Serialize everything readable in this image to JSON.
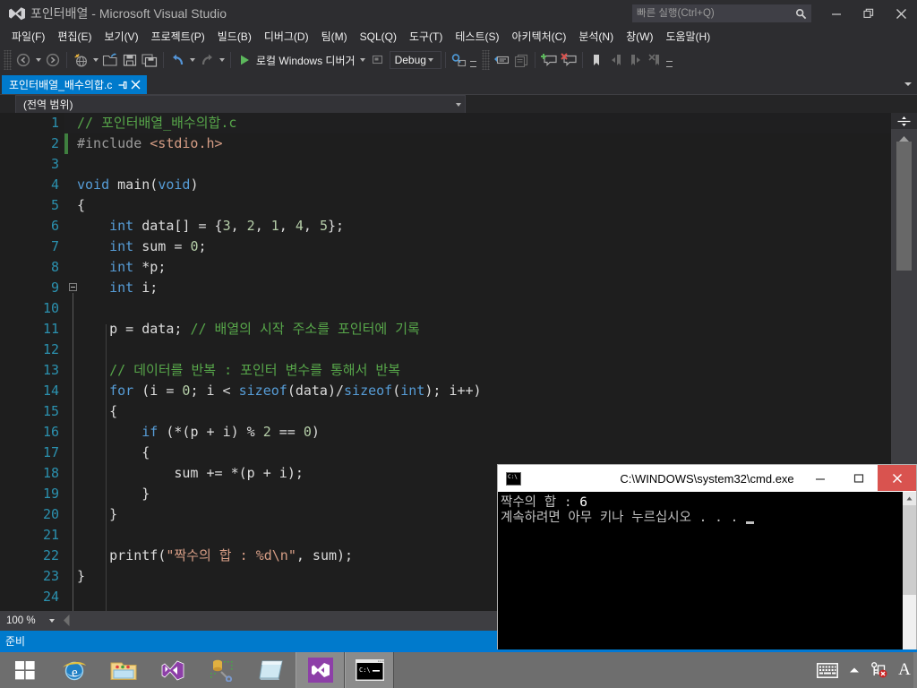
{
  "window": {
    "app_name": "Microsoft Visual Studio",
    "project_name": "포인터배열",
    "title": "포인터배열 - Microsoft Visual Studio",
    "logo_icon": "visual-studio-logo-icon",
    "minimize_icon": "minimize-icon",
    "restore_icon": "restore-icon",
    "close_icon": "close-icon",
    "accent_color": "#007acc",
    "chrome_color": "#2d2d30"
  },
  "quick_launch": {
    "placeholder": "빠른 실행(Ctrl+Q)",
    "value": "",
    "icon": "search-icon"
  },
  "menubar": {
    "items": [
      {
        "label": "파일(F)",
        "name": "menu-file"
      },
      {
        "label": "편집(E)",
        "name": "menu-edit"
      },
      {
        "label": "보기(V)",
        "name": "menu-view"
      },
      {
        "label": "프로젝트(P)",
        "name": "menu-project"
      },
      {
        "label": "빌드(B)",
        "name": "menu-build"
      },
      {
        "label": "디버그(D)",
        "name": "menu-debug"
      },
      {
        "label": "팀(M)",
        "name": "menu-team"
      },
      {
        "label": "SQL(Q)",
        "name": "menu-sql"
      },
      {
        "label": "도구(T)",
        "name": "menu-tools"
      },
      {
        "label": "테스트(S)",
        "name": "menu-test"
      },
      {
        "label": "아키텍처(C)",
        "name": "menu-architecture"
      },
      {
        "label": "분석(N)",
        "name": "menu-analyze"
      },
      {
        "label": "창(W)",
        "name": "menu-window"
      },
      {
        "label": "도움말(H)",
        "name": "menu-help"
      }
    ]
  },
  "toolbar": {
    "navigate_back_icon": "navigate-back-icon",
    "navigate_forward_icon": "navigate-forward-icon",
    "new_project_icon": "new-project-icon",
    "open_file_icon": "open-file-icon",
    "save_icon": "save-icon",
    "save_all_icon": "save-all-icon",
    "undo_icon": "undo-icon",
    "redo_icon": "redo-icon",
    "start_debug_icon": "play-triangle-icon",
    "start_debug_label": "로컬 Windows 디버거",
    "platform_target_icon": "target-platform-icon",
    "configuration_value": "Debug",
    "find_icon": "find-in-files-icon",
    "comment_icon": "comment-selection-icon",
    "uncomment_icon": "uncomment-selection-icon",
    "add_comment_icon": "add-comment-icon",
    "delete_comment_icon": "delete-comment-icon",
    "bookmark_icon": "bookmark-icon",
    "prev_bookmark_icon": "previous-bookmark-icon",
    "next_bookmark_icon": "next-bookmark-icon",
    "clear_bookmarks_icon": "clear-bookmarks-icon",
    "overflow_icon": "toolbar-overflow-icon"
  },
  "document_tab": {
    "filename": "포인터배열_배수의합.c",
    "pin_icon": "pin-icon",
    "close_icon": "close-icon",
    "dropdown_icon": "chevron-down-icon",
    "active_color": "#007acc"
  },
  "scope_bar": {
    "value": "(전역 범위)",
    "dropdown_icon": "chevron-down-icon"
  },
  "editor": {
    "filename": "포인터배열_배수의합.c",
    "language": "c",
    "total_lines_visible": 24,
    "lines": [
      {
        "n": "1",
        "text": "// 포인터배열_배수의합.c"
      },
      {
        "n": "2",
        "text": "#include <stdio.h>"
      },
      {
        "n": "3",
        "text": ""
      },
      {
        "n": "4",
        "text": "void main(void)"
      },
      {
        "n": "5",
        "text": "{"
      },
      {
        "n": "6",
        "text": "    int data[] = {3, 2, 1, 4, 5};"
      },
      {
        "n": "7",
        "text": "    int sum = 0;"
      },
      {
        "n": "8",
        "text": "    int *p;"
      },
      {
        "n": "9",
        "text": "    int i;"
      },
      {
        "n": "10",
        "text": ""
      },
      {
        "n": "11",
        "text": "    p = data; // 배열의 시작 주소를 포인터에 기록"
      },
      {
        "n": "12",
        "text": ""
      },
      {
        "n": "13",
        "text": "    // 데이터를 반복 : 포인터 변수를 통해서 반복"
      },
      {
        "n": "14",
        "text": "    for (i = 0; i < sizeof(data)/sizeof(int); i++)"
      },
      {
        "n": "15",
        "text": "    {"
      },
      {
        "n": "16",
        "text": "        if (*(p + i) % 2 == 0)"
      },
      {
        "n": "17",
        "text": "        {"
      },
      {
        "n": "18",
        "text": "            sum += *(p + i);"
      },
      {
        "n": "19",
        "text": "        }"
      },
      {
        "n": "20",
        "text": "    }"
      },
      {
        "n": "21",
        "text": ""
      },
      {
        "n": "22",
        "text": "    printf(\"짝수의 합 : %d\\n\", sum);"
      },
      {
        "n": "23",
        "text": "}"
      },
      {
        "n": "24",
        "text": ""
      }
    ],
    "splitter_icon": "horizontal-splitter-icon",
    "scroll_up_icon": "scroll-up-icon"
  },
  "zoom_bar": {
    "zoom_level": "100 %",
    "dropdown_icon": "chevron-down-icon",
    "scroll_left_icon": "scroll-left-icon"
  },
  "status_bar": {
    "text": "준비",
    "color": "#007acc"
  },
  "console": {
    "title": "C:\\WINDOWS\\system32\\cmd.exe",
    "icon": "cmd-console-icon",
    "minimize_icon": "minimize-icon",
    "maximize_icon": "maximize-icon",
    "close_icon": "close-icon",
    "close_color": "#d9534f",
    "output_line1_label": "짝수의 합 : ",
    "output_line1_value": "6",
    "output_line2": "계속하려면 아무 키나 누르십시오 . . .",
    "cursor": "block-cursor"
  },
  "taskbar": {
    "items": [
      {
        "name": "start-button",
        "icon": "windows-logo-icon",
        "active": false
      },
      {
        "name": "taskbar-internet-explorer",
        "icon": "internet-explorer-icon",
        "active": false
      },
      {
        "name": "taskbar-file-explorer",
        "icon": "file-explorer-icon",
        "active": false
      },
      {
        "name": "taskbar-visual-studio",
        "icon": "visual-studio-icon",
        "active": false
      },
      {
        "name": "taskbar-sql-tools",
        "icon": "database-tools-icon",
        "active": false
      },
      {
        "name": "taskbar-notepad",
        "icon": "notepad-icon",
        "active": false
      },
      {
        "name": "taskbar-visual-studio-running",
        "icon": "visual-studio-icon",
        "active": true
      },
      {
        "name": "taskbar-cmd-running",
        "icon": "cmd-console-icon",
        "active": true
      }
    ],
    "tray": [
      {
        "name": "tray-touch-keyboard",
        "icon": "keyboard-icon"
      },
      {
        "name": "tray-show-hidden-icons",
        "icon": "chevron-up-icon"
      },
      {
        "name": "tray-network-disconnected",
        "icon": "network-error-icon"
      },
      {
        "name": "tray-input-method",
        "icon": "ime-letter-A-icon",
        "label": "A"
      }
    ]
  }
}
